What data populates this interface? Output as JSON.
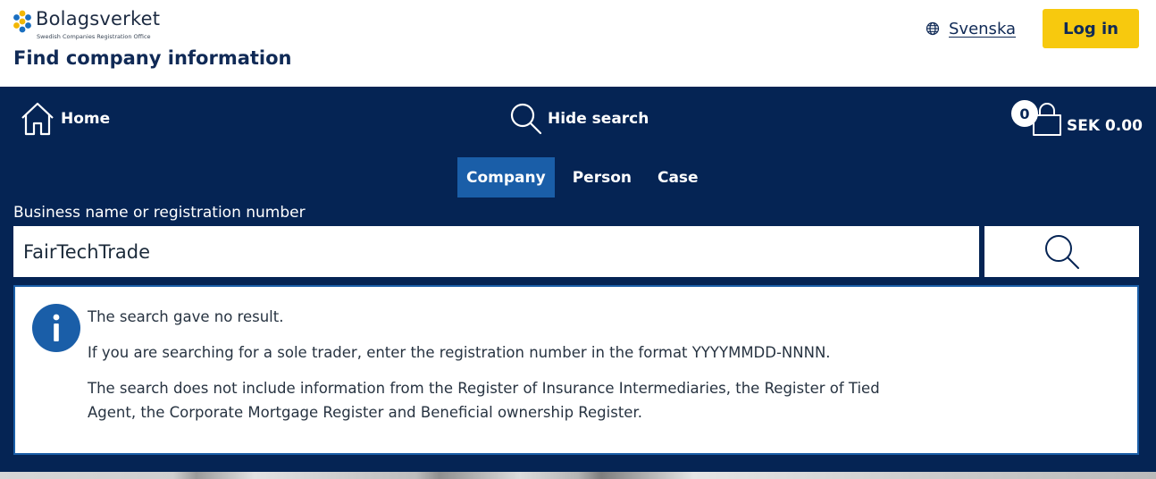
{
  "header": {
    "logo_name": "Bolagsverket",
    "logo_subtitle": "Swedish Companies Registration Office",
    "page_title": "Find company information",
    "language_link": "Svenska",
    "login_label": "Log in"
  },
  "nav": {
    "home_label": "Home",
    "hide_search_label": "Hide search",
    "cart_count": "0",
    "cart_total": "SEK 0.00"
  },
  "search": {
    "tabs": [
      {
        "label": "Company",
        "active": true
      },
      {
        "label": "Person",
        "active": false
      },
      {
        "label": "Case",
        "active": false
      }
    ],
    "field_label": "Business name or registration number",
    "value": "FairTechTrade"
  },
  "info": {
    "messages": [
      "The search gave no result.",
      "If you are searching for a sole trader, enter the registration number in the format YYYYMMDD-NNNN.",
      "The search does not include information from the Register of Insurance Intermediaries, the Register of Tied Agent, the Corporate Mortgage Register and Beneficial ownership Register."
    ]
  },
  "icons": {
    "logo": "bolagsverket-logo-icon",
    "language": "globe-icon",
    "home": "home-icon",
    "search": "search-icon",
    "cart": "shopping-bag-icon",
    "info": "info-icon"
  },
  "colors": {
    "navy": "#052454",
    "accent_blue": "#1a5ea8",
    "login_yellow": "#f7c90e",
    "title_navy": "#102a56"
  }
}
